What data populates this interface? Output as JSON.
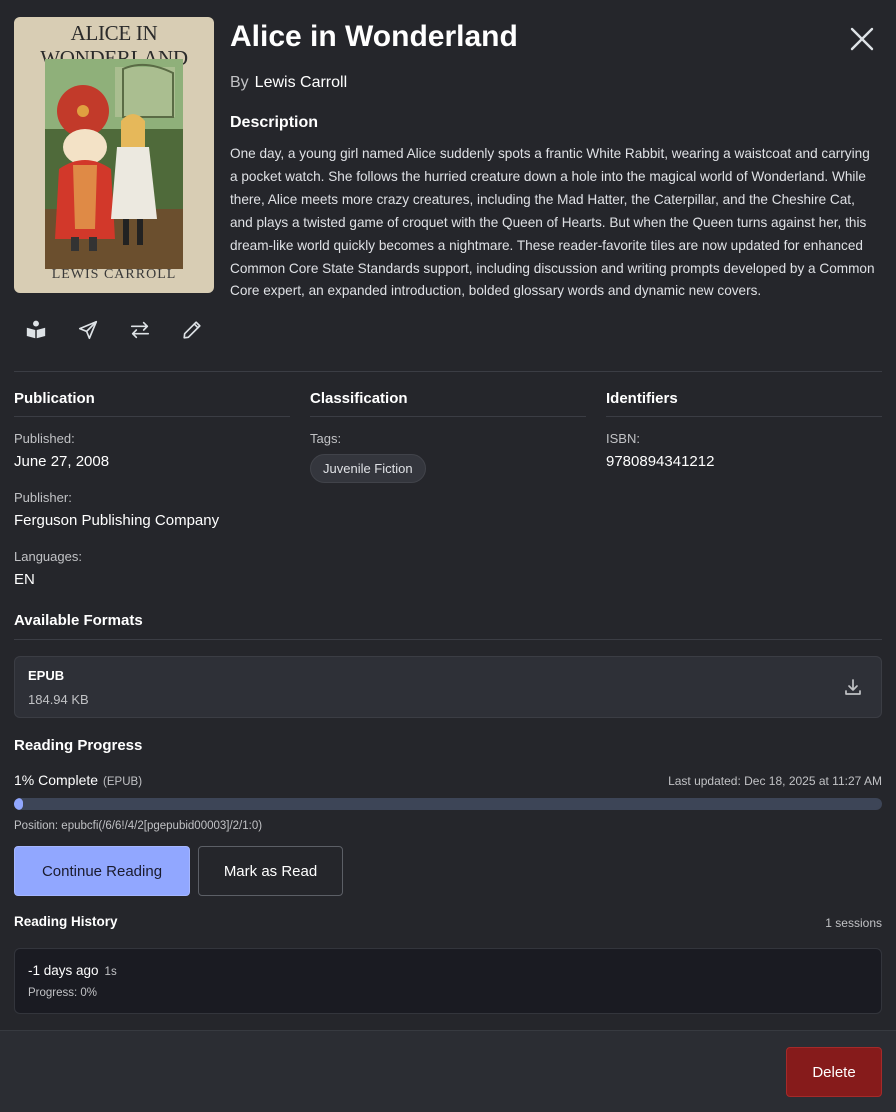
{
  "book": {
    "title": "Alice in Wonderland",
    "by_label": "By",
    "author": "Lewis Carroll",
    "cover": {
      "title_text": "ALICE IN WONDERLAND",
      "author_text": "LEWIS CARROLL"
    }
  },
  "description": {
    "heading": "Description",
    "text": "One day, a young girl named Alice suddenly spots a frantic White Rabbit, wearing a waistcoat and carrying a pocket watch. She follows the hurried creature down a hole into the magical world of Wonderland. While there, Alice meets more crazy creatures, including the Mad Hatter, the Caterpillar, and the Cheshire Cat, and plays a twisted game of croquet with the Queen of Hearts. But when the Queen turns against her, this dream-like world quickly becomes a nightmare. These reader-favorite tiles are now updated for enhanced Common Core State Standards support, including discussion and writing prompts developed by a Common Core expert, an expanded introduction, bolded glossary words and dynamic new covers."
  },
  "publication": {
    "heading": "Publication",
    "published_label": "Published:",
    "published": "June 27, 2008",
    "publisher_label": "Publisher:",
    "publisher": "Ferguson Publishing Company",
    "languages_label": "Languages:",
    "languages": "EN"
  },
  "classification": {
    "heading": "Classification",
    "tags_label": "Tags:",
    "tags": [
      "Juvenile Fiction"
    ]
  },
  "identifiers": {
    "heading": "Identifiers",
    "isbn_label": "ISBN:",
    "isbn": "9780894341212"
  },
  "formats": {
    "heading": "Available Formats",
    "items": [
      {
        "name": "EPUB",
        "size": "184.94 KB"
      }
    ]
  },
  "progress": {
    "heading": "Reading Progress",
    "complete_text": "1% Complete",
    "format_text": "(EPUB)",
    "percent": 1,
    "updated": "Last updated: Dec 18, 2025 at 11:27 AM",
    "position": "Position: epubcfi(/6/6!/4/2[pgepubid00003]/2/1:0)",
    "continue_label": "Continue Reading",
    "mark_read_label": "Mark as Read"
  },
  "history": {
    "heading": "Reading History",
    "count_text": "1 sessions",
    "sessions": [
      {
        "when": "-1 days ago",
        "duration": "1s",
        "progress": "Progress: 0%"
      }
    ]
  },
  "footer": {
    "delete_label": "Delete"
  },
  "colors": {
    "background": "#25262b",
    "accent": "#91a7ff",
    "danger": "#861b1b",
    "progress_track": "#3d4557"
  },
  "icons": {
    "read": "book-open-icon",
    "send": "send-icon",
    "convert": "arrows-swap-icon",
    "edit": "pencil-icon",
    "close": "close-icon",
    "download": "download-icon"
  }
}
